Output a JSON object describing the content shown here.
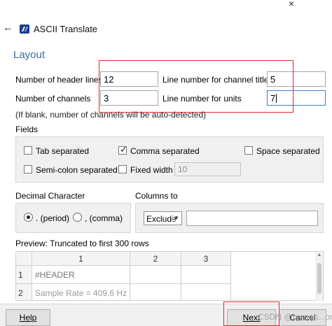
{
  "window": {
    "close_glyph": "×",
    "back_glyph": "←",
    "app_title": "ASCII Translate"
  },
  "layout": {
    "section_title": "Layout",
    "header_lines_label": "Number of header lines",
    "header_lines_value": "12",
    "channel_titles_label": "Line number for channel titles",
    "channel_titles_value": "5",
    "channels_label": "Number of channels",
    "channels_value": "3",
    "units_label": "Line number for units",
    "units_value": "7",
    "hint": "(If blank, number of channels will be auto-detected)"
  },
  "fields": {
    "title": "Fields",
    "tab_separated": {
      "label": "Tab separated",
      "checked": false
    },
    "comma_separated": {
      "label": "Comma separated",
      "checked": true
    },
    "space_separated": {
      "label": "Space separated",
      "checked": false
    },
    "semicolon_separated": {
      "label": "Semi-colon separated",
      "checked": false
    },
    "fixed_width": {
      "label": "Fixed width",
      "checked": false,
      "value": "10"
    }
  },
  "decimal": {
    "title": "Decimal Character",
    "period_label": ". (period)",
    "comma_label": ", (comma)",
    "selected": "period"
  },
  "columns_to": {
    "title": "Columns to",
    "mode": "Exclude",
    "value": ""
  },
  "preview": {
    "title": "Preview: Truncated to first 300 rows",
    "columns": [
      "1",
      "2",
      "3"
    ],
    "rows": [
      {
        "index": "1",
        "cells": [
          "#HEADER",
          "",
          ""
        ]
      },
      {
        "index": "2",
        "cells": [
          "Sample Rate = 409.6 Hz",
          "",
          ""
        ]
      }
    ]
  },
  "footer": {
    "help_label": "Help",
    "next_label": "Next",
    "cancel_label": "Cancel"
  },
  "watermark": "CSDN @Lemon...on",
  "colors": {
    "accent_title": "#3b6aa5",
    "highlight_red": "#e12a2a",
    "focus_blue": "#3c7fd6",
    "app_icon": "#1f3d86"
  }
}
